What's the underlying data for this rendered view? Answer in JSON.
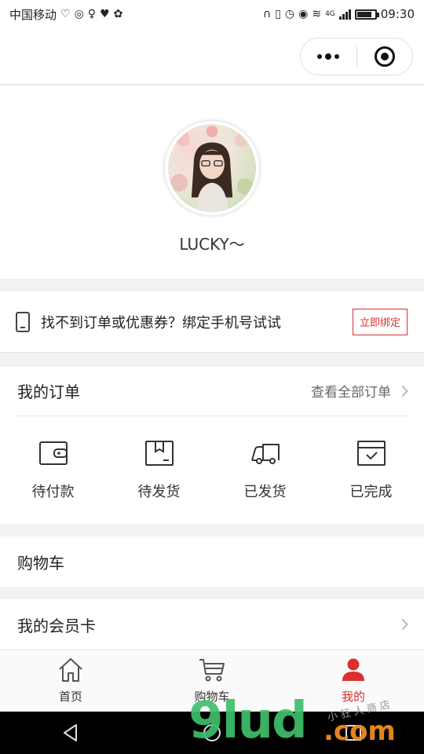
{
  "status_bar": {
    "carrier": "中国移动",
    "network": "4G",
    "time": "09:30",
    "battery_level": 0.85
  },
  "nav": {
    "more_icon": "more-dots-icon",
    "close_icon": "target-close-icon"
  },
  "profile": {
    "username": "LUCKY～"
  },
  "bind_phone": {
    "text": "找不到订单或优惠券？绑定手机号试试",
    "button_label": "立即绑定"
  },
  "orders": {
    "title": "我的订单",
    "view_all": "查看全部订单",
    "items": [
      {
        "label": "待付款",
        "icon": "wallet-icon"
      },
      {
        "label": "待发货",
        "icon": "box-icon"
      },
      {
        "label": "已发货",
        "icon": "truck-icon"
      },
      {
        "label": "已完成",
        "icon": "completed-box-icon"
      }
    ]
  },
  "menu": {
    "cart": "购物车",
    "member_card": "我的会员卡"
  },
  "tabs": [
    {
      "label": "首页",
      "icon": "home-icon"
    },
    {
      "label": "购物车",
      "icon": "cart-icon"
    },
    {
      "label": "我的",
      "icon": "user-icon",
      "active": true
    }
  ],
  "colors": {
    "accent": "#d9302f"
  },
  "watermark": {
    "main": "9lud",
    "tld": ".com",
    "small": "小狂人商店"
  }
}
